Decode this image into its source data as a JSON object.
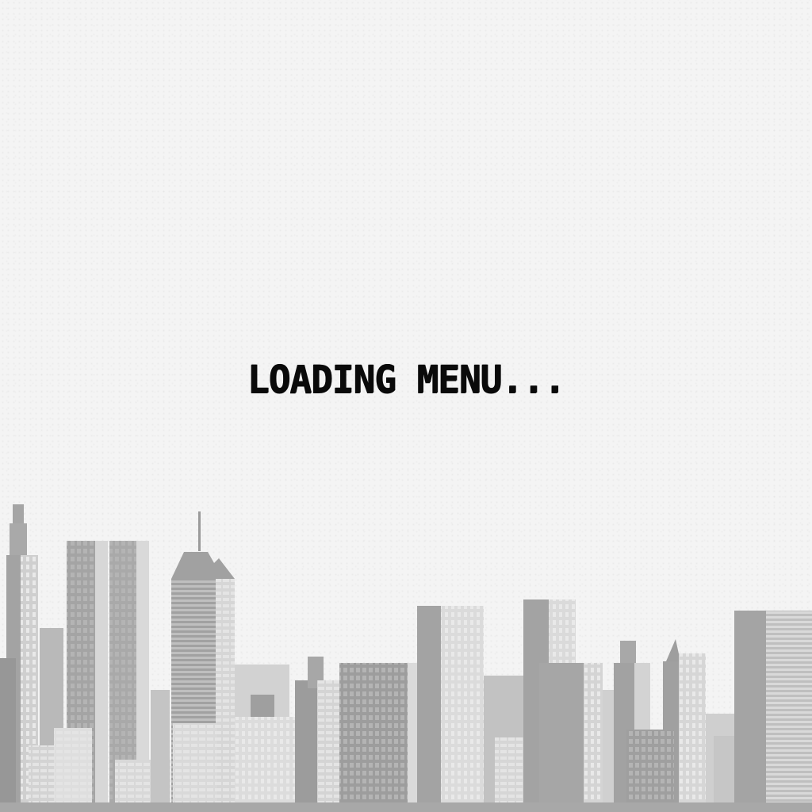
{
  "screen": {
    "loading_text": "LOADING MENU...",
    "background_color": "#f4f4f4",
    "text_color": "#0a0a0a"
  },
  "skyline": {
    "description_icon": "city-skyline-icon",
    "colors": {
      "dark": "#8f8f8f",
      "mid": "#aaaaaa",
      "light": "#c9c9c9",
      "lighter": "#dcdcdc",
      "window": "#ededed",
      "ground": "#a8a8a8"
    }
  }
}
